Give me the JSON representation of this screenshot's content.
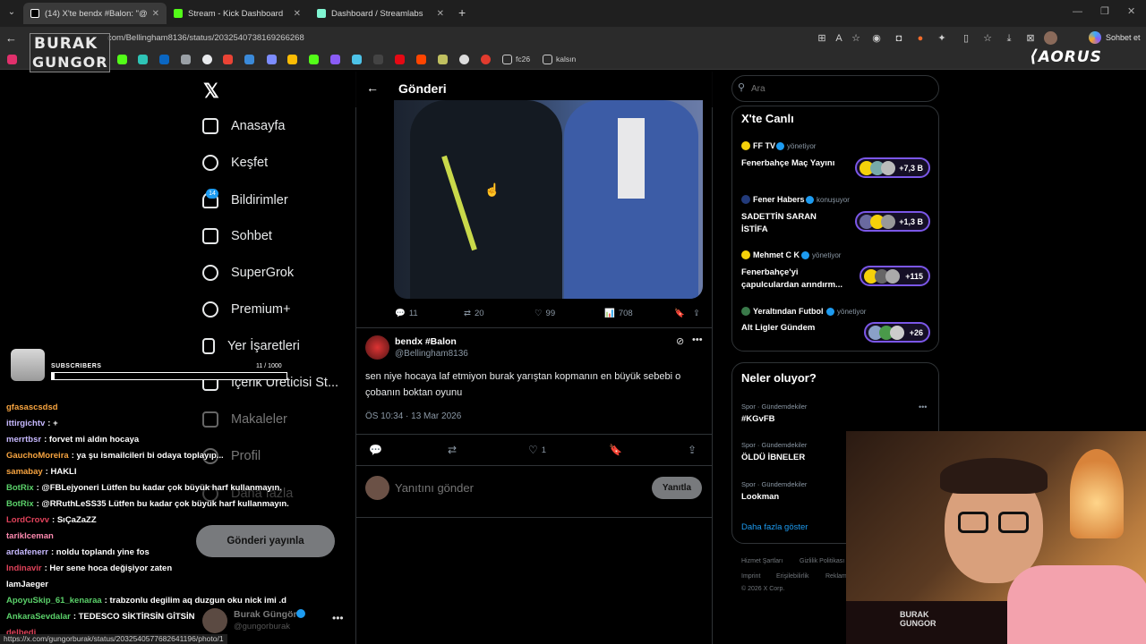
{
  "browser": {
    "tabs": [
      {
        "title": "(14) X'te bendx #Balon: \"@gungor",
        "active": true,
        "color": "#ffffff"
      },
      {
        "title": "Stream - Kick Dashboard",
        "active": false,
        "color": "#53fc18"
      },
      {
        "title": "Dashboard / Streamlabs",
        "active": false,
        "color": "#80f5d2"
      }
    ],
    "url": "com/Bellingham8136/status/2032540738169266268",
    "bookmarks": [
      {
        "label": "fc26"
      },
      {
        "label": "kalsın"
      }
    ],
    "copilot_label": "Sohbet et",
    "status_url": "https://x.com/gungorburak/status/2032540577682641196/photo/1"
  },
  "overlay": {
    "logo_line1": "BURAK",
    "logo_line2": "GUNGOR",
    "brand": "AORUS",
    "subscribers_label": "SUBSCRIBERS",
    "subscribers_count": "11 / 1000",
    "subscribers_fraction": 0.011,
    "chair_label_1": "BURAK",
    "chair_label_2": "GUNGOR"
  },
  "nav": {
    "items": [
      {
        "label": "Anasayfa",
        "icon": "home-icon"
      },
      {
        "label": "Keşfet",
        "icon": "search-icon"
      },
      {
        "label": "Bildirimler",
        "icon": "bell-icon",
        "badge": "14"
      },
      {
        "label": "Sohbet",
        "icon": "mail-icon"
      },
      {
        "label": "SuperGrok",
        "icon": "grok-icon"
      },
      {
        "label": "Premium+",
        "icon": "premium-icon"
      },
      {
        "label": "Yer İşaretleri",
        "icon": "bookmark-icon"
      },
      {
        "label": "İçerik Üreticisi St...",
        "icon": "lightning-icon"
      },
      {
        "label": "Makaleler",
        "icon": "article-icon"
      },
      {
        "label": "Profil",
        "icon": "profile-icon"
      },
      {
        "label": "Daha fazla",
        "icon": "more-icon"
      }
    ],
    "post_button": "Gönderi yayınla",
    "account": {
      "name": "Burak Güngör",
      "handle": "@gungorburak"
    }
  },
  "post_view": {
    "header_title": "Gönderi",
    "image_post_stats": {
      "replies": "11",
      "reposts": "20",
      "likes": "99",
      "views": "708"
    },
    "reply": {
      "display_name": "bendx #Balon",
      "handle": "@Bellingham8136",
      "text": "sen niye hocaya laf etmiyon burak yarıştan kopmanın en büyük sebebi o çobanın boktan oyunu",
      "timestamp": "ÖS 10:34 · 13 Mar 2026",
      "likes": "1"
    },
    "composer": {
      "placeholder": "Yanıtını gönder",
      "button": "Yanıtla"
    }
  },
  "sidebar": {
    "search_placeholder": "Ara",
    "live": {
      "title": "X'te Canlı",
      "items": [
        {
          "host": "FF TV",
          "role": "yönetiyor",
          "title": "Fenerbahçe Maç Yayını",
          "count": "+7,3 B"
        },
        {
          "host": "Fener Habers",
          "role": "konuşuyor",
          "title": "SADETTİN SARAN İSTİFA",
          "count": "+1,3 B"
        },
        {
          "host": "Mehmet C K",
          "role": "yönetiyor",
          "title": "Fenerbahçe'yi çapulculardan arındırm...",
          "count": "+115"
        },
        {
          "host": "Yeraltından Futbol",
          "role": "yönetiyor",
          "title": "Alt Ligler Gündem",
          "count": "+26"
        }
      ]
    },
    "trends": {
      "title": "Neler oluyor?",
      "items": [
        {
          "category": "Spor · Gündemdekiler",
          "name": "#KGvFB"
        },
        {
          "category": "Spor · Gündemdekiler",
          "name": "ÖLDÜ İBNELER"
        },
        {
          "category": "Spor · Gündemdekiler",
          "name": "Lookman"
        }
      ],
      "show_more": "Daha fazla göster"
    },
    "footer": [
      "Hizmet Şartları",
      "Gizlilik Politikası",
      "Imprint",
      "Erişilebilirlik",
      "Reklam",
      "© 2026 X Corp."
    ]
  },
  "chat": [
    {
      "user": "gfasascsdsd",
      "msg": "",
      "color": "#f7a440"
    },
    {
      "user": "ittirgichtv",
      "msg": ": +",
      "color": "#c7b9ff"
    },
    {
      "user": "merrtbsr",
      "msg": ": forvet mi aldın hocaya",
      "color": "#c7b9ff"
    },
    {
      "user": "GauchoMoreira",
      "msg": ": ya şu ismailcileri bi odaya toplayıp...",
      "color": "#f7a440"
    },
    {
      "user": "samabay",
      "msg": ": HAKLI",
      "color": "#f7a440"
    },
    {
      "user": "BotRix",
      "msg": ": @FBLejyoneri Lütfen bu kadar çok büyük harf kullanmayın.",
      "color": "#5bd16a"
    },
    {
      "user": "BotRix",
      "msg": ": @RRuthLeSS35 Lütfen bu kadar çok büyük harf kullanmayın.",
      "color": "#5bd16a"
    },
    {
      "user": "LordCrovv",
      "msg": ": SıÇaZaZZ",
      "color": "#e0425a"
    },
    {
      "user": "tarikIceman",
      "msg": "",
      "color": "#ff8ab0"
    },
    {
      "user": "ardafenerr",
      "msg": ": noldu toplandı yine fos",
      "color": "#c7b9ff"
    },
    {
      "user": "Indinavir",
      "msg": ": Her sene hoca değişiyor zaten",
      "color": "#e0425a"
    },
    {
      "user": "IamJaeger",
      "msg": "",
      "color": "#ffffff"
    },
    {
      "user": "ApoyuSkip_61_kenaraa",
      "msg": ": trabzonlu degilim aq duzgun oku nick imi .d",
      "color": "#5bd16a"
    },
    {
      "user": "AnkaraSevdalar",
      "msg": ": TEDESCO SİKTİRSİN GİTSİN",
      "color": "#5bd16a"
    },
    {
      "user": "delbedi",
      "msg": "",
      "color": "#e0425a"
    }
  ]
}
